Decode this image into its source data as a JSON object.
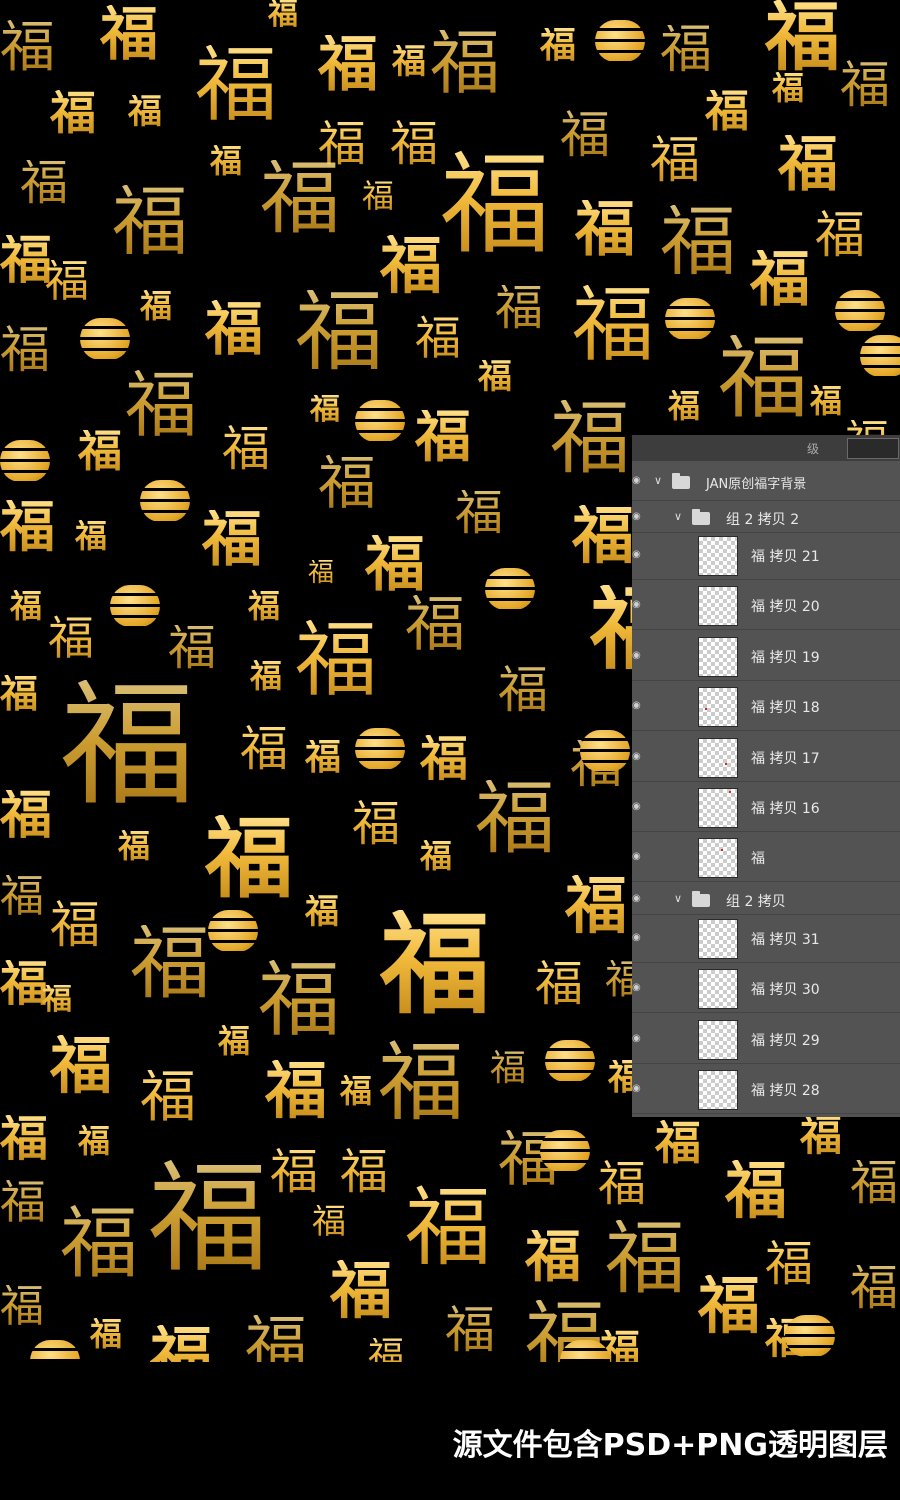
{
  "pattern": {
    "glyph": "福"
  },
  "layers_panel": {
    "top_mode_label": "级",
    "root_group": "JAN原创福字背景",
    "groups": [
      {
        "name": "组 2 拷贝 2",
        "layers": [
          "福 拷贝 21",
          "福 拷贝 20",
          "福 拷贝 19",
          "福 拷贝 18",
          "福 拷贝 17",
          "福 拷贝 16",
          "福"
        ]
      },
      {
        "name": "组 2 拷贝",
        "layers": [
          "福 拷贝 31",
          "福 拷贝 30",
          "福 拷贝 29",
          "福 拷贝 28"
        ]
      }
    ],
    "colors": {
      "panel_bg": "#535353",
      "text": "#e8e8e8"
    }
  },
  "caption": "源文件包含PSD+PNG透明图层",
  "colors": {
    "background": "#000000",
    "gold_light": "#ffe08a",
    "gold_dark": "#c48a1a"
  }
}
